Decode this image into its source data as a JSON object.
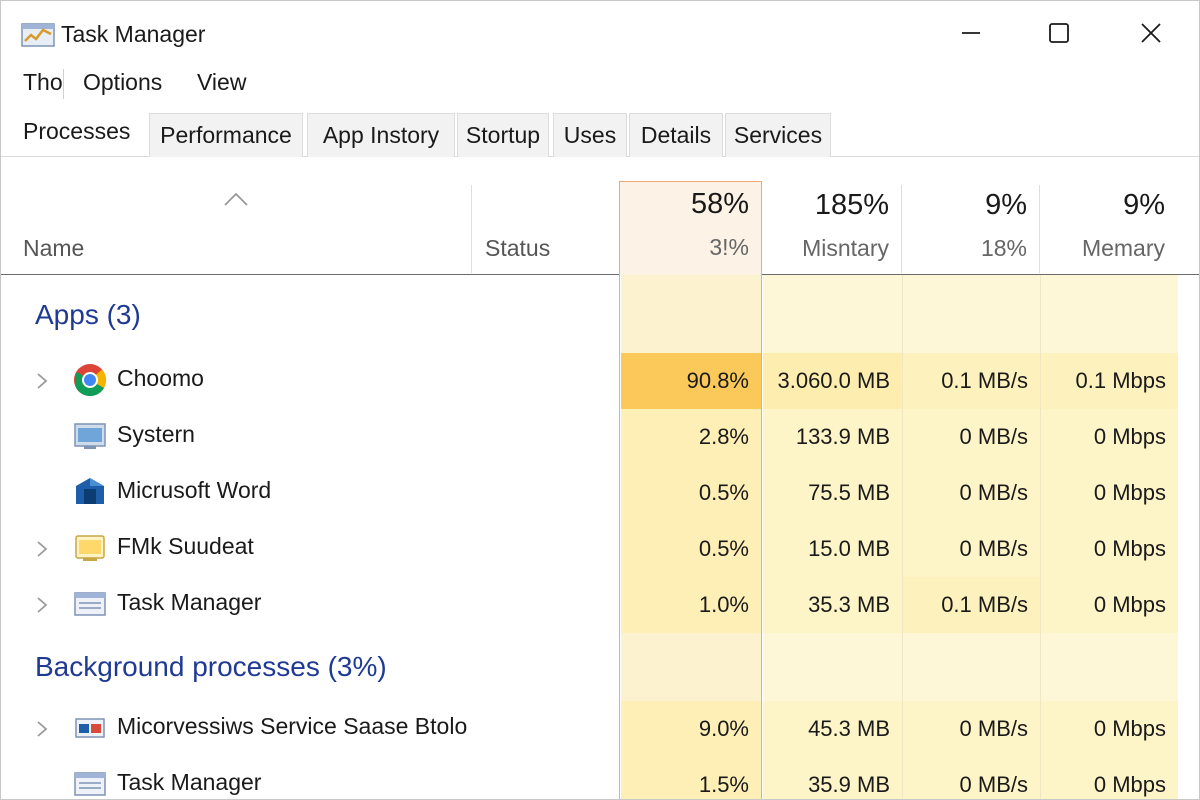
{
  "window": {
    "title": "Task Manager",
    "controls": {
      "minimize": "minimize",
      "maximize": "maximize",
      "close": "close"
    }
  },
  "menu": {
    "items": [
      {
        "label": "Tho"
      },
      {
        "label": "Options"
      },
      {
        "label": "View"
      }
    ]
  },
  "tabs": [
    {
      "label": "Processes",
      "active": true
    },
    {
      "label": "Performance"
    },
    {
      "label": "App Instory"
    },
    {
      "label": "Stortup"
    },
    {
      "label": "Uses"
    },
    {
      "label": "Details"
    },
    {
      "label": "Services"
    }
  ],
  "columns": {
    "name": "Name",
    "status": "Status",
    "cpu": {
      "percent": "58%",
      "label": "3!%"
    },
    "memory": {
      "percent": "185%",
      "label": "Misntary"
    },
    "disk": {
      "percent": "9%",
      "label": "18%"
    },
    "network": {
      "percent": "9%",
      "label": "Memary"
    }
  },
  "groups": {
    "apps": {
      "label": "Apps (3)"
    },
    "background": {
      "label": "Background processes (3%)"
    }
  },
  "apps": [
    {
      "name": "Choomo",
      "icon": "chrome-icon",
      "expandable": true,
      "cpu": "90.8%",
      "memory": "3.060.0 MB",
      "disk": "0.1 MB/s",
      "network": "0.1 Mbps"
    },
    {
      "name": "Systern",
      "icon": "system-icon",
      "expandable": false,
      "cpu": "2.8%",
      "memory": "133.9 MB",
      "disk": "0 MB/s",
      "network": "0 Mbps"
    },
    {
      "name": "Micrusoft Word",
      "icon": "word-icon",
      "expandable": false,
      "cpu": "0.5%",
      "memory": "75.5 MB",
      "disk": "0 MB/s",
      "network": "0 Mbps"
    },
    {
      "name": "FMk Suudeat",
      "icon": "folder-icon",
      "expandable": true,
      "cpu": "0.5%",
      "memory": "15.0 MB",
      "disk": "0 MB/s",
      "network": "0 Mbps"
    },
    {
      "name": "Task Manager",
      "icon": "task-manager-icon",
      "expandable": true,
      "cpu": "1.0%",
      "memory": "35.3 MB",
      "disk": "0.1 MB/s",
      "network": "0 Mbps"
    }
  ],
  "background": [
    {
      "name": "Micorvessiws Service Saase Btolo",
      "icon": "service-icon",
      "expandable": true,
      "cpu": "9.0%",
      "memory": "45.3 MB",
      "disk": "0 MB/s",
      "network": "0 Mbps"
    },
    {
      "name": "Task Manager",
      "icon": "task-manager-icon",
      "expandable": false,
      "cpu": "1.5%",
      "memory": "35.9 MB",
      "disk": "0 MB/s",
      "network": "0 Mbps"
    }
  ],
  "colors": {
    "accent": "#1f3a93",
    "cpu_border": "#f0a877",
    "heat_high": "#fbc85a",
    "heat_low": "#fdf4c5"
  }
}
